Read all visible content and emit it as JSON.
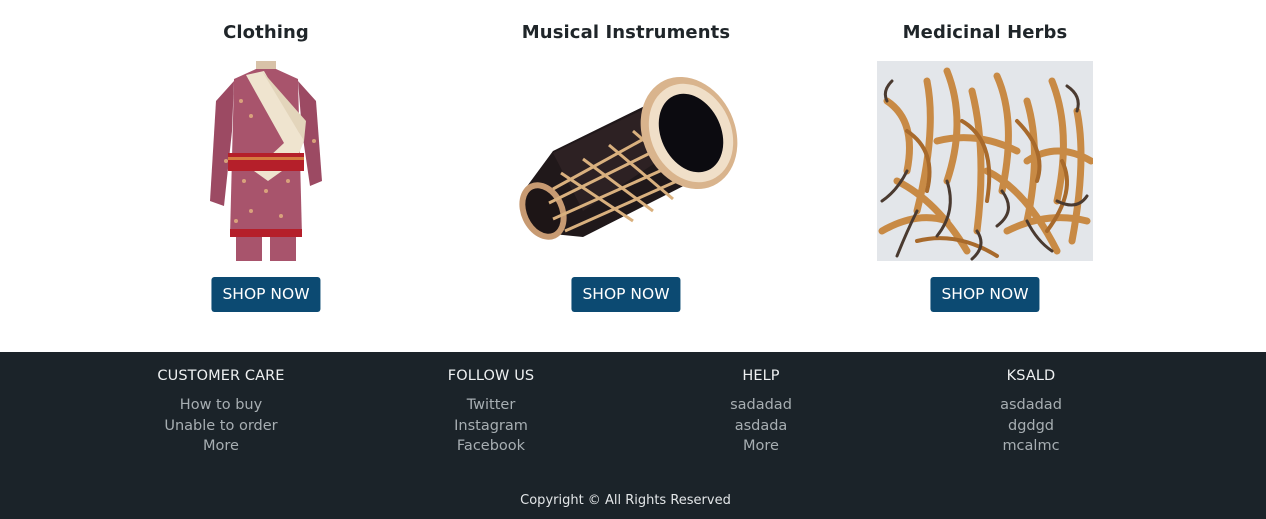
{
  "products": [
    {
      "title": "Clothing",
      "button": "SHOP NOW",
      "image": "traditional-clothing-image"
    },
    {
      "title": "Musical Instruments",
      "button": "SHOP NOW",
      "image": "madal-drum-image"
    },
    {
      "title": "Medicinal Herbs",
      "button": "SHOP NOW",
      "image": "cordyceps-herbs-image"
    }
  ],
  "footer": {
    "columns": [
      {
        "heading": "CUSTOMER CARE",
        "links": [
          "How to buy",
          "Unable to order",
          "More"
        ]
      },
      {
        "heading": "FOLLOW US",
        "links": [
          "Twitter",
          "Instagram",
          "Facebook"
        ]
      },
      {
        "heading": "HELP",
        "links": [
          "sadadad",
          "asdada",
          "More"
        ]
      },
      {
        "heading": "KSALD",
        "links": [
          "asdadad",
          "dgdgd",
          "mcalmc"
        ]
      }
    ],
    "copyright": "Copyright © All Rights Reserved"
  },
  "colors": {
    "button_bg": "#0c4a72",
    "footer_bg": "#1b2329",
    "footer_link": "#a7aeb2"
  }
}
